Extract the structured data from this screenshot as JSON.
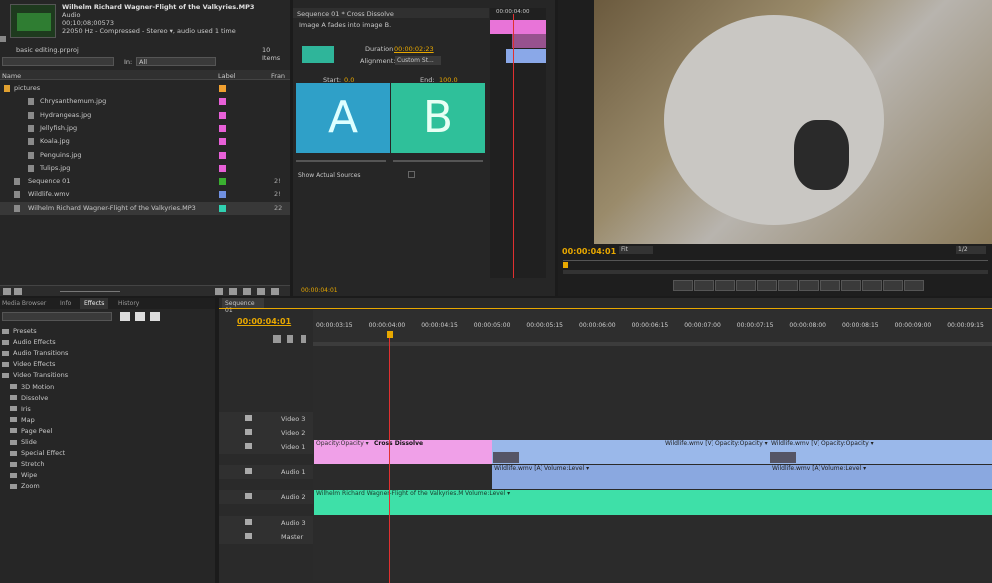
{
  "project": {
    "clip_title": "Wilhelm Richard Wagner-Flight of the Valkyries.MP3",
    "clip_type": "Audio",
    "clip_duration": "00;10;08;00573",
    "clip_format": "22050 Hz - Compressed - Stereo ▾, audio used 1 time",
    "project_name": "basic editing.prproj",
    "item_count": "10 Items",
    "search_placeholder": "",
    "in_label": "In:",
    "in_value": "All",
    "col_name": "Name",
    "col_label": "Label",
    "col_frame": "Fran",
    "items": [
      {
        "name": "pictures",
        "color": "#f0a030",
        "frame": "",
        "type": "folder"
      },
      {
        "name": "Chrysanthemum.jpg",
        "color": "#e860d8",
        "frame": "",
        "type": "image"
      },
      {
        "name": "Hydrangeas.jpg",
        "color": "#e860d8",
        "frame": "",
        "type": "image"
      },
      {
        "name": "Jellyfish.jpg",
        "color": "#e860d8",
        "frame": "",
        "type": "image"
      },
      {
        "name": "Koala.jpg",
        "color": "#e860d8",
        "frame": "",
        "type": "image"
      },
      {
        "name": "Penguins.jpg",
        "color": "#e860d8",
        "frame": "",
        "type": "image"
      },
      {
        "name": "Tulips.jpg",
        "color": "#e860d8",
        "frame": "",
        "type": "image"
      },
      {
        "name": "Sequence 01",
        "color": "#3ab030",
        "frame": "2!",
        "type": "sequence"
      },
      {
        "name": "Wildlife.wmv",
        "color": "#7090e0",
        "frame": "2!",
        "type": "video"
      },
      {
        "name": "Wilhelm Richard Wagner-Flight of the Valkyries.MP3",
        "color": "#30d0b0",
        "frame": "22",
        "type": "audio"
      }
    ]
  },
  "effect_controls": {
    "title": "Sequence 01 * Cross Dissolve",
    "description": "Image A fades into image B.",
    "duration_label": "Duration",
    "duration_value": "00:00:02:23",
    "alignment_label": "Alignment:",
    "alignment_value": "Custom St...",
    "start_label": "Start:",
    "start_value": "0.0",
    "end_label": "End:",
    "end_value": "100.0",
    "a_label": "A",
    "b_label": "B",
    "show_sources": "Show Actual Sources",
    "mini_tc": "00:00:04:00",
    "bottom_tc": "00:00:04:01"
  },
  "monitor": {
    "timecode": "00:00:04:01",
    "fit": "Fit",
    "resolution": "1/2"
  },
  "effects_panel": {
    "tabs": [
      "Media Browser",
      "Info",
      "Effects",
      "History"
    ],
    "items": [
      {
        "label": "Presets",
        "level": 0
      },
      {
        "label": "Audio Effects",
        "level": 0
      },
      {
        "label": "Audio Transitions",
        "level": 0
      },
      {
        "label": "Video Effects",
        "level": 0
      },
      {
        "label": "Video Transitions",
        "level": 0
      },
      {
        "label": "3D Motion",
        "level": 1
      },
      {
        "label": "Dissolve",
        "level": 1
      },
      {
        "label": "Iris",
        "level": 1
      },
      {
        "label": "Map",
        "level": 1
      },
      {
        "label": "Page Peel",
        "level": 1
      },
      {
        "label": "Slide",
        "level": 1
      },
      {
        "label": "Special Effect",
        "level": 1
      },
      {
        "label": "Stretch",
        "level": 1
      },
      {
        "label": "Wipe",
        "level": 1
      },
      {
        "label": "Zoom",
        "level": 1
      }
    ]
  },
  "timeline": {
    "tab": "Sequence 01",
    "timecode": "00:00:04:01",
    "ticks": [
      "00:00:03:15",
      "00:00:04:00",
      "00:00:04:15",
      "00:00:05:00",
      "00:00:05:15",
      "00:00:06:00",
      "00:00:06:15",
      "00:00:07:00",
      "00:00:07:15",
      "00:00:08:00",
      "00:00:08:15",
      "00:00:09:00",
      "00:00:09:15"
    ],
    "tracks": [
      "Video 3",
      "Video 2",
      "Video 1",
      "Audio 1",
      "Audio 2",
      "Audio 3",
      "Master"
    ],
    "clips": {
      "pink_clip": "Opacity:Opacity ▾",
      "transition": "Cross Dissolve",
      "wild1": "Wildlife.wmv [V]",
      "wild1_op": "Opacity:Opacity ▾",
      "wild2": "Wildlife.wmv [V]",
      "wild2_op": "Opacity:Opacity ▾",
      "wild_a1": "Wildlife.wmv [A]",
      "wild_a1_vol": "Volume:Level ▾",
      "wild_a2": "Wildlife.wmv [A]",
      "wild_a2_vol": "Volume:Level ▾",
      "music": "Wilhelm Richard Wagner-Flight of the Valkyries.MP3",
      "music_vol": "Volume:Level ▾"
    }
  }
}
